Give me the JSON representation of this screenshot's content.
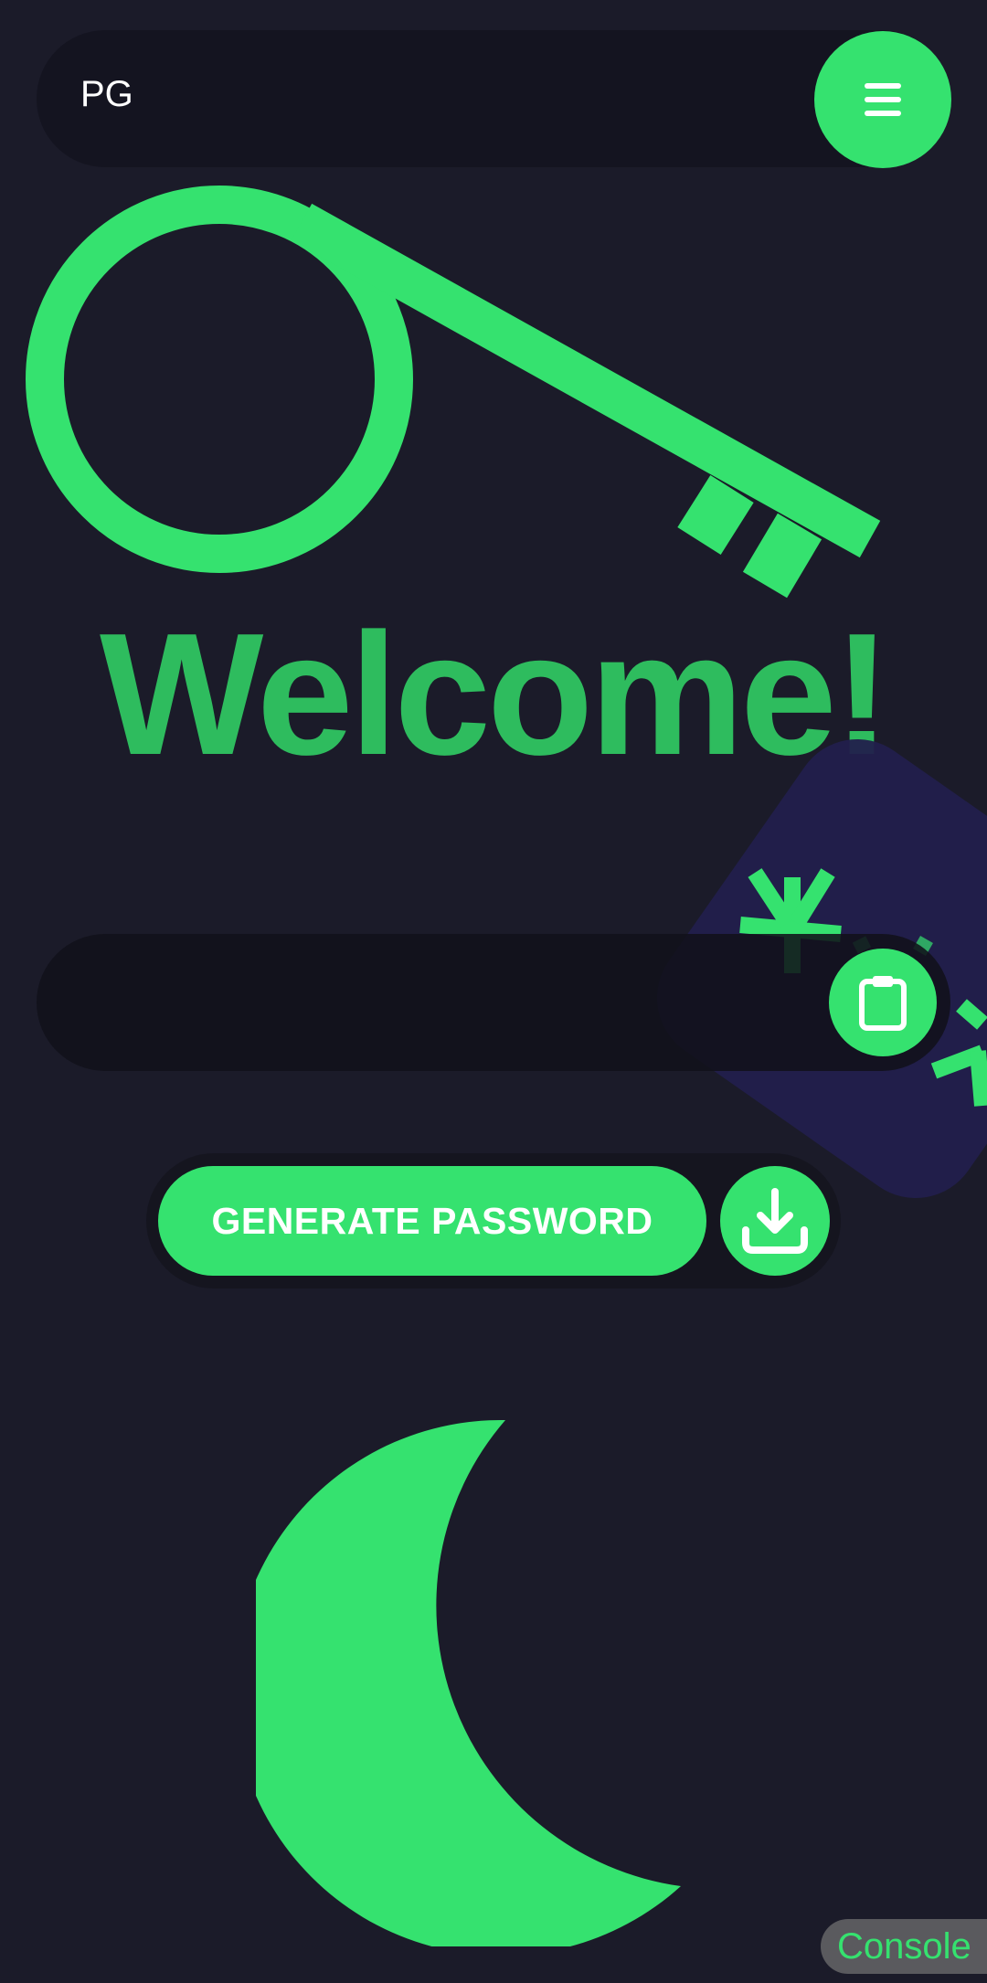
{
  "header": {
    "logo_text": "PG",
    "menu_icon": "hamburger-menu-icon"
  },
  "hero": {
    "illustration_icon": "key-icon",
    "title": "Welcome!"
  },
  "password": {
    "value": "",
    "copy_icon": "clipboard-icon"
  },
  "actions": {
    "generate_label": "GENERATE PASSWORD",
    "download_icon": "download-icon"
  },
  "theme": {
    "toggle_icon": "moon-icon"
  },
  "console": {
    "label": "Console"
  },
  "colors": {
    "background": "#1b1b29",
    "accent": "#35e26f",
    "heading": "#2ebc5e",
    "surface": "#141420",
    "blob": "#221f4c"
  }
}
